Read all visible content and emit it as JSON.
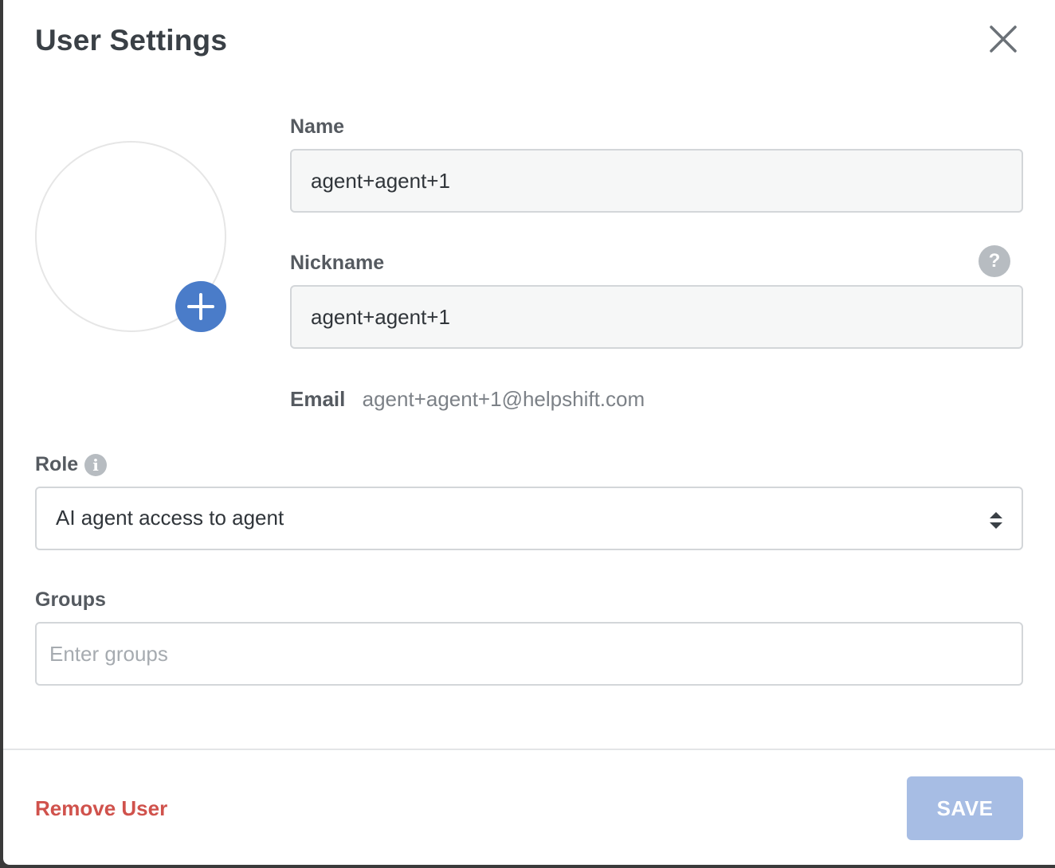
{
  "modal": {
    "title": "User Settings"
  },
  "icons": {
    "close": "close-icon",
    "add_photo": "plus-icon",
    "nickname_help": "question-mark-icon",
    "role_info": "info-icon",
    "select_arrows": "sort-arrows-icon"
  },
  "name": {
    "label": "Name",
    "value": "agent+agent+1"
  },
  "nickname": {
    "label": "Nickname",
    "value": "agent+agent+1",
    "help_symbol": "?"
  },
  "email": {
    "label": "Email",
    "value": "agent+agent+1@helpshift.com"
  },
  "role": {
    "label": "Role",
    "info_symbol": "i",
    "selected": "AI agent access to agent"
  },
  "groups": {
    "label": "Groups",
    "value": "",
    "placeholder": "Enter groups"
  },
  "footer": {
    "remove_label": "Remove User",
    "save_label": "SAVE"
  },
  "colors": {
    "accent": "#4a7cc9",
    "save_disabled": "#a7bde4",
    "danger": "#d0524c",
    "title_text": "#3a4046",
    "muted_text": "#7c8187"
  }
}
